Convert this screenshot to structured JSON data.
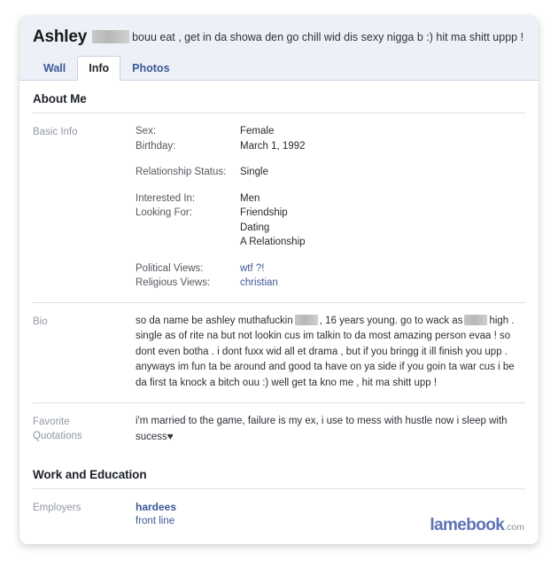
{
  "profile": {
    "name": "Ashley",
    "name_redacted": true,
    "status_text": "bouu eat , get in da showa den go chill wid dis sexy nigga b :) hit ma shitt uppp !",
    "tabs": [
      {
        "label": "Wall",
        "active": false
      },
      {
        "label": "Info",
        "active": true
      },
      {
        "label": "Photos",
        "active": false
      }
    ]
  },
  "about": {
    "heading": "About Me",
    "basic_info": {
      "label": "Basic Info",
      "pairs": [
        {
          "key": "Sex:",
          "value": "Female"
        },
        {
          "key": "Birthday:",
          "value": "March 1, 1992"
        }
      ],
      "relationship": {
        "key": "Relationship Status:",
        "value": "Single"
      },
      "interested": {
        "key": "Interested In:",
        "value": "Men"
      },
      "looking_for": {
        "key": "Looking For:",
        "values": [
          "Friendship",
          "Dating",
          "A Relationship"
        ]
      },
      "views": [
        {
          "key": "Political Views:",
          "value": "wtf ?!",
          "is_link": true
        },
        {
          "key": "Religious Views:",
          "value": "christian",
          "is_link": true
        }
      ]
    },
    "bio": {
      "label": "Bio",
      "part1": "so da name be ashley muthafuckin",
      "part2": ", 16 years young. go to wack as",
      "part3": "high . single as of rite na but not lookin cus im talkin to da most amazing person evaa ! so dont even botha . i dont fuxx wid all et drama , but if you bringg it ill finish you upp . anyways im fun ta be around and good ta have on ya side if you goin ta war cus i be da first ta knock a bitch ouu :) well get ta kno me , hit ma shitt upp !"
    },
    "quotations": {
      "label_line1": "Favorite",
      "label_line2": "Quotations",
      "text": "i'm married to the game, failure is my ex, i use to mess with hustle now i sleep with sucess",
      "heart": "♥"
    }
  },
  "work": {
    "heading": "Work and Education",
    "employers": {
      "label": "Employers",
      "name": "hardees",
      "role": "front line"
    }
  },
  "watermark": {
    "name": "lamebook",
    "tld": ".com"
  }
}
